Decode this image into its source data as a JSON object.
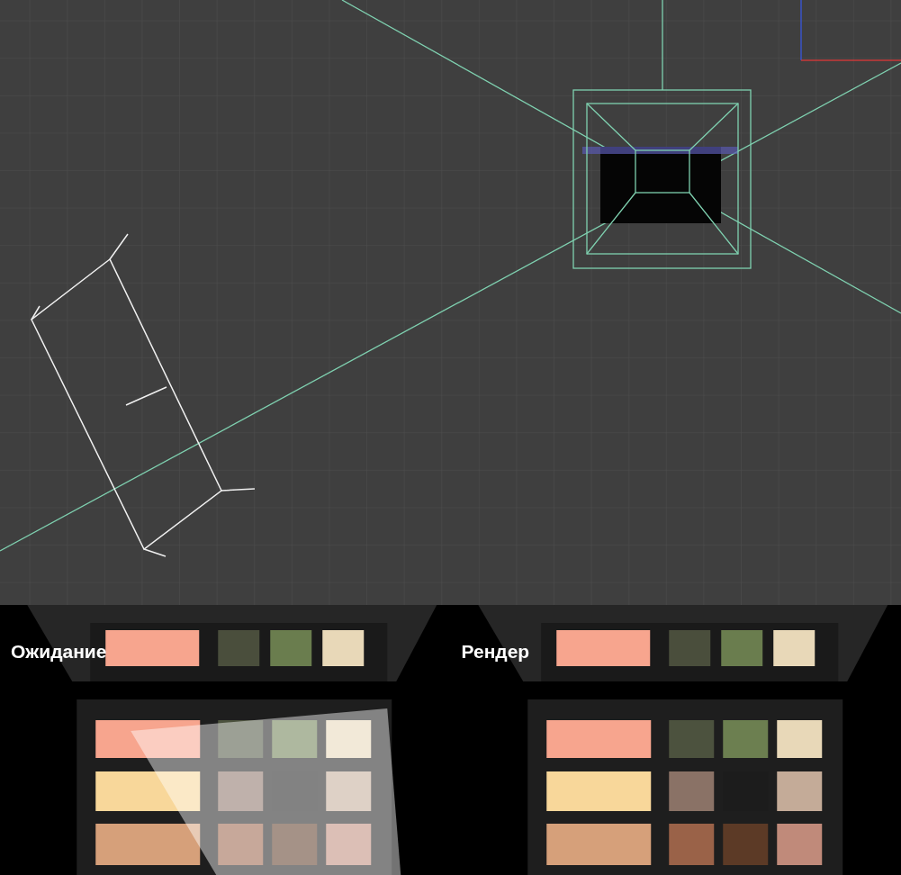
{
  "renders": [
    {
      "label": "Ожидание",
      "kind": "expected"
    },
    {
      "label": "Рендер",
      "kind": "render"
    }
  ]
}
